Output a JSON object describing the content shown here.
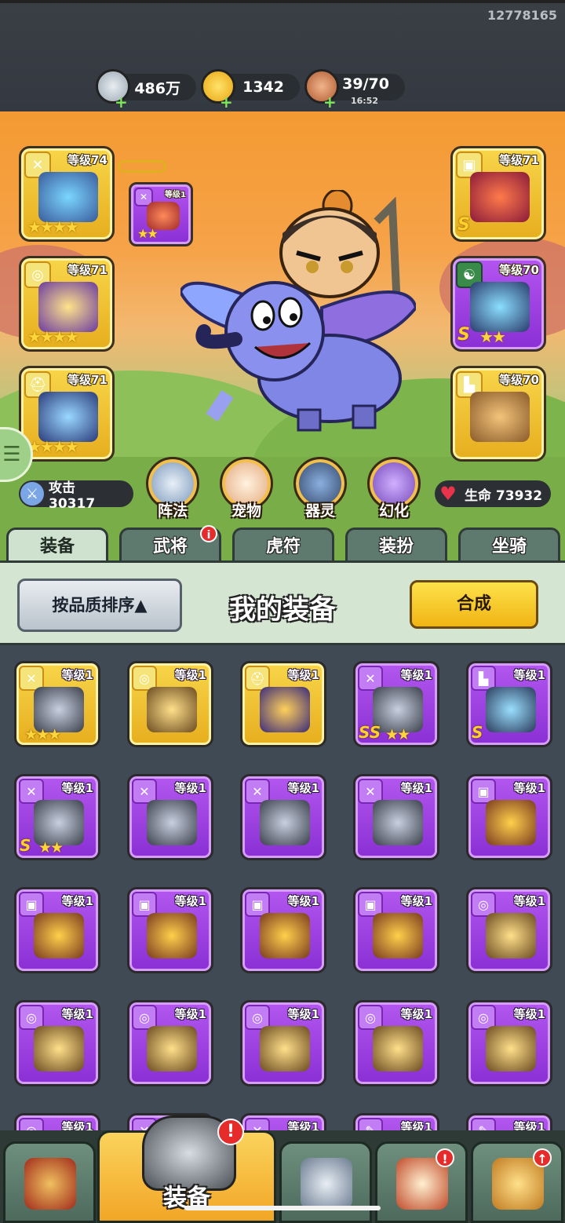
{
  "uid": "12778165",
  "resources": {
    "coins": "486万",
    "gold": "1342",
    "stamina": "39/70",
    "stamina_timer": "16:52"
  },
  "scene": {
    "left_slots": [
      {
        "level": "等级74",
        "tag": "sword-icon",
        "stars": "★★★★",
        "quality": "gold"
      },
      {
        "level": "等级71",
        "tag": "medal-icon",
        "stars": "★★★★",
        "quality": "gold"
      },
      {
        "level": "等级71",
        "tag": "helmet-icon",
        "stars": "★★★★",
        "quality": "gold"
      }
    ],
    "linked_slot": {
      "level": "等级1",
      "stars": "★★"
    },
    "right_slots": [
      {
        "level": "等级71",
        "tag": "armor-icon",
        "grade": "S",
        "stars": "",
        "quality": "gold"
      },
      {
        "level": "等级70",
        "tag": "yinyang-icon",
        "grade": "S",
        "stars": "★★",
        "quality": "purple"
      },
      {
        "level": "等级70",
        "tag": "boot-icon",
        "grade": "",
        "stars": "",
        "quality": "gold"
      }
    ],
    "attack_label": "攻击 30317",
    "life_label": "生命 73932",
    "circle_buttons": [
      "阵法",
      "宠物",
      "器灵",
      "幻化"
    ]
  },
  "tabs": [
    "装备",
    "武将",
    "虎符",
    "装扮",
    "坐骑"
  ],
  "panel": {
    "sort_label": "按品质排序▲",
    "title": "我的装备",
    "combine_label": "合成"
  },
  "items": [
    {
      "level": "等级1",
      "quality": "gold",
      "tag": "sword-icon",
      "grade": "",
      "stars": "★★★"
    },
    {
      "level": "等级1",
      "quality": "gold",
      "tag": "medal-icon",
      "grade": "",
      "stars": ""
    },
    {
      "level": "等级1",
      "quality": "gold",
      "tag": "helmet-icon",
      "grade": "",
      "stars": ""
    },
    {
      "level": "等级1",
      "quality": "purple",
      "tag": "sword-icon",
      "grade": "SS",
      "stars": "★★"
    },
    {
      "level": "等级1",
      "quality": "purple",
      "tag": "boot-icon",
      "grade": "S",
      "stars": ""
    },
    {
      "level": "等级1",
      "quality": "purple",
      "tag": "sword-icon",
      "grade": "S",
      "stars": "★★"
    },
    {
      "level": "等级1",
      "quality": "purple",
      "tag": "sword-icon",
      "grade": "",
      "stars": ""
    },
    {
      "level": "等级1",
      "quality": "purple",
      "tag": "sword-icon",
      "grade": "",
      "stars": ""
    },
    {
      "level": "等级1",
      "quality": "purple",
      "tag": "sword-icon",
      "grade": "",
      "stars": ""
    },
    {
      "level": "等级1",
      "quality": "purple",
      "tag": "armor-icon",
      "grade": "",
      "stars": ""
    },
    {
      "level": "等级1",
      "quality": "purple",
      "tag": "armor-icon",
      "grade": "",
      "stars": ""
    },
    {
      "level": "等级1",
      "quality": "purple",
      "tag": "armor-icon",
      "grade": "",
      "stars": ""
    },
    {
      "level": "等级1",
      "quality": "purple",
      "tag": "armor-icon",
      "grade": "",
      "stars": ""
    },
    {
      "level": "等级1",
      "quality": "purple",
      "tag": "armor-icon",
      "grade": "",
      "stars": ""
    },
    {
      "level": "等级1",
      "quality": "purple",
      "tag": "medal-icon",
      "grade": "",
      "stars": ""
    },
    {
      "level": "等级1",
      "quality": "purple",
      "tag": "medal-icon",
      "grade": "",
      "stars": ""
    },
    {
      "level": "等级1",
      "quality": "purple",
      "tag": "medal-icon",
      "grade": "",
      "stars": ""
    },
    {
      "level": "等级1",
      "quality": "purple",
      "tag": "medal-icon",
      "grade": "",
      "stars": ""
    },
    {
      "level": "等级1",
      "quality": "purple",
      "tag": "medal-icon",
      "grade": "",
      "stars": ""
    },
    {
      "level": "等级1",
      "quality": "purple",
      "tag": "medal-icon",
      "grade": "",
      "stars": ""
    },
    {
      "level": "等级1",
      "quality": "purple",
      "tag": "medal-icon",
      "grade": "",
      "stars": ""
    },
    {
      "level": "等级1",
      "quality": "purple",
      "tag": "sword-icon",
      "grade": "",
      "stars": ""
    },
    {
      "level": "等级1",
      "quality": "purple",
      "tag": "sword-icon",
      "grade": "",
      "stars": ""
    },
    {
      "level": "等级1",
      "quality": "purple",
      "tag": "scroll-icon",
      "grade": "",
      "stars": ""
    },
    {
      "level": "等级1",
      "quality": "purple",
      "tag": "scroll-icon",
      "grade": "",
      "stars": ""
    }
  ],
  "bottom_nav": {
    "active_label": "装备",
    "alert": "!"
  }
}
